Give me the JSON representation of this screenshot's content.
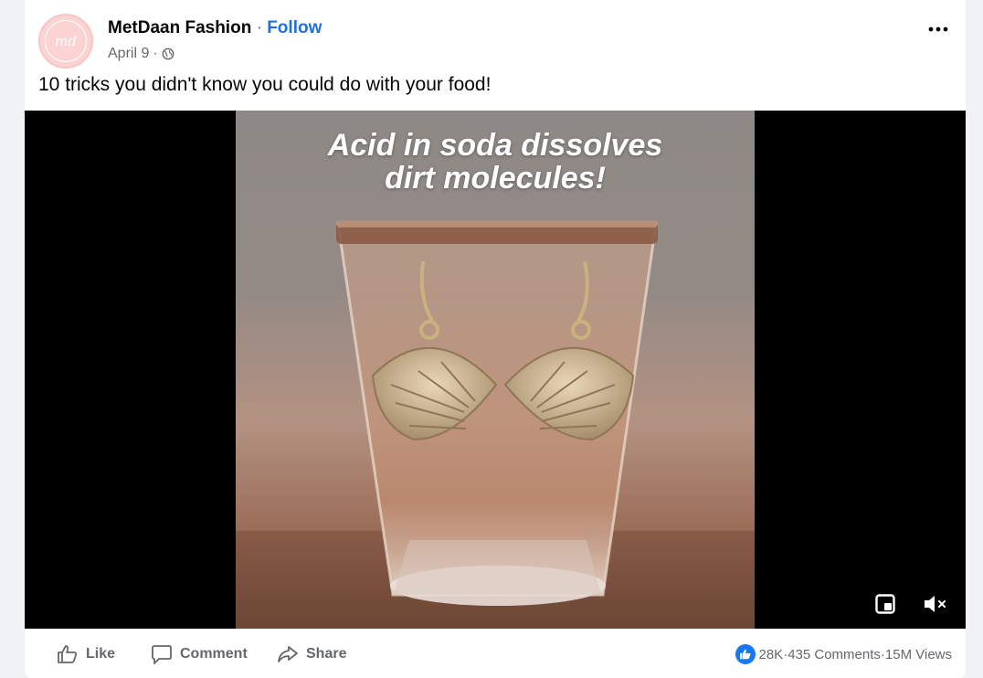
{
  "post": {
    "page_name": "MetDaan Fashion",
    "separator": " · ",
    "follow_label": "Follow",
    "date": "April 9",
    "meta_separator": "·",
    "privacy_icon": "globe-icon",
    "avatar_text": "md",
    "text": "10 tricks you didn't know you could do with your food!"
  },
  "video": {
    "caption_line1": "Acid in soda dissolves",
    "caption_line2": "dirt molecules!",
    "controls": [
      "miniplayer-icon",
      "mute-icon"
    ]
  },
  "actions": {
    "like_label": "Like",
    "comment_label": "Comment",
    "share_label": "Share"
  },
  "stats": {
    "reactions": "28K",
    "sep1": " · ",
    "comments": "435 Comments",
    "sep2": " · ",
    "views": "15M Views"
  },
  "colors": {
    "accent": "#216fdb",
    "like_blue": "#1877f2",
    "muted_text": "#65676b",
    "background": "#f0f2f5"
  }
}
